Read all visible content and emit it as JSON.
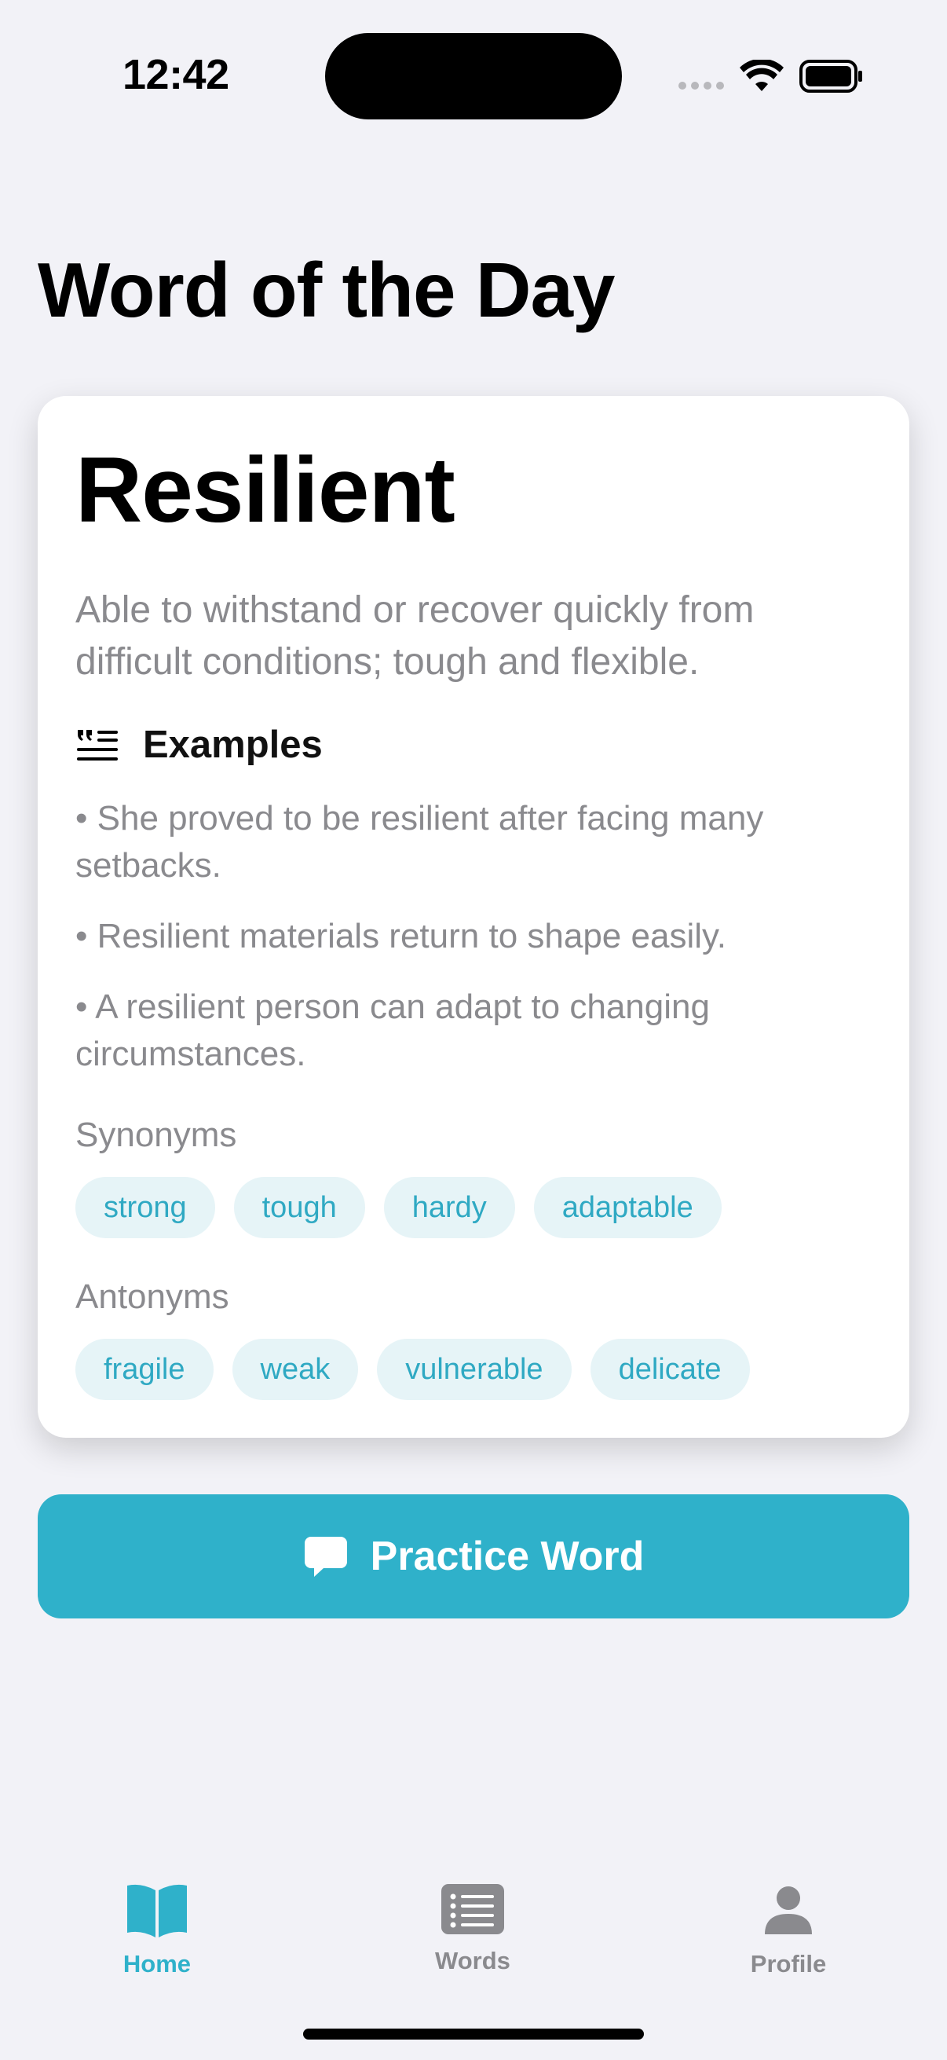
{
  "status_bar": {
    "time": "12:42"
  },
  "page_title": "Word of the Day",
  "word": {
    "term": "Resilient",
    "definition": "Able to withstand or recover quickly from difficult conditions; tough and flexible.",
    "examples_title": "Examples",
    "examples": [
      "• She proved to be resilient after facing many setbacks.",
      "• Resilient materials return to shape easily.",
      "• A resilient person can adapt to changing circumstances."
    ],
    "synonyms_label": "Synonyms",
    "synonyms": [
      "strong",
      "tough",
      "hardy",
      "adaptable"
    ],
    "antonyms_label": "Antonyms",
    "antonyms": [
      "fragile",
      "weak",
      "vulnerable",
      "delicate"
    ]
  },
  "practice_button": {
    "label": "Practice Word",
    "icon": "speech-bubble-icon"
  },
  "tab_bar": {
    "items": [
      {
        "label": "Home",
        "icon": "book-icon",
        "active": true
      },
      {
        "label": "Words",
        "icon": "list-icon",
        "active": false
      },
      {
        "label": "Profile",
        "icon": "person-icon",
        "active": false
      }
    ]
  },
  "colors": {
    "accent": "#2FB1CA",
    "chip_background": "#E6F4F7",
    "chip_text": "#2FA9C3",
    "inactive_tab": "#8A8A8E",
    "page_background": "#F2F2F7"
  }
}
